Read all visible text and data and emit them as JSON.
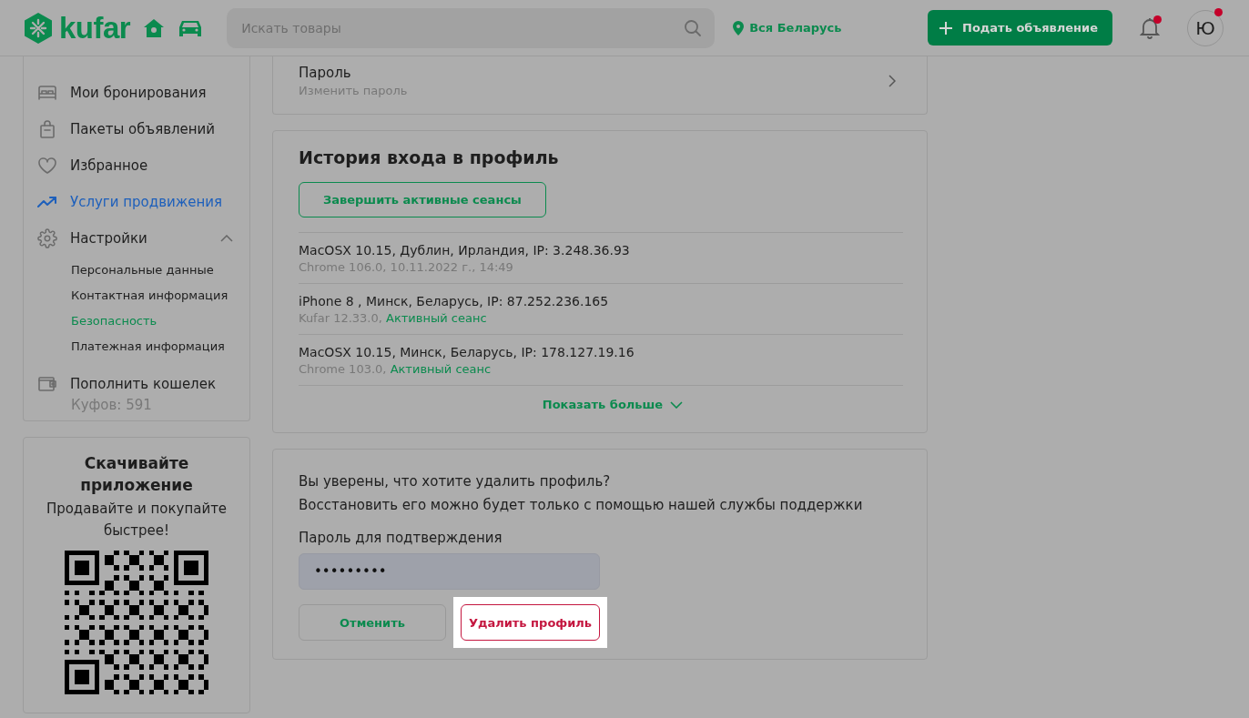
{
  "header": {
    "logo_text": "kufar",
    "search": {
      "placeholder": "Искать товары"
    },
    "location": "Вся Беларусь",
    "post_button": "Подать объявление",
    "notifications": {
      "unread": true
    },
    "avatar": {
      "letter": "Ю",
      "unread": true
    }
  },
  "sidebar": {
    "items": [
      {
        "label": "Мои бронирования",
        "highlighted": false
      },
      {
        "label": "Пакеты объявлений",
        "highlighted": false
      },
      {
        "label": "Избранное",
        "highlighted": false
      },
      {
        "label": "Услуги продвижения",
        "highlighted": true
      },
      {
        "label": "Настройки",
        "highlighted": false,
        "expanded": true,
        "children": [
          {
            "label": "Персональные данные",
            "selected": false
          },
          {
            "label": "Контактная информация",
            "selected": false
          },
          {
            "label": "Безопасность",
            "selected": true
          },
          {
            "label": "Платежная информация",
            "selected": false
          }
        ]
      },
      {
        "label": "Пополнить кошелек",
        "highlighted": false,
        "subtitle": "Куфов: 591"
      }
    ]
  },
  "app_promo": {
    "title": "Скачивайте приложение",
    "text": "Продавайте и покупайте быстрее!"
  },
  "password_card": {
    "title": "Пароль",
    "subtitle": "Изменить пароль"
  },
  "login_history": {
    "title": "История входа в профиль",
    "end_sessions_button": "Завершить активные сеансы",
    "sessions": [
      {
        "device": "MacOSX 10.15, Дублин, Ирландия, IP: 3.248.36.93",
        "details": "Chrome 106.0, 10.11.2022 г., 14:49"
      },
      {
        "device": "iPhone 8 , Минск, Беларусь, IP: 87.252.236.165",
        "details": "Kufar 12.33.0,",
        "status": "Активный сеанс"
      },
      {
        "device": "MacOSX 10.15, Минск, Беларусь, IP: 178.127.19.16",
        "details": "Chrome 103.0,",
        "status": "Активный сеанс"
      }
    ],
    "show_more": "Показать больше"
  },
  "delete_profile": {
    "question": "Вы уверены, что хотите удалить профиль?",
    "note": "Восстановить его можно будет только с помощью нашей службы поддержки",
    "password_label": "Пароль для подтверждения",
    "password_value": "•••••••••",
    "cancel_button": "Отменить",
    "delete_button": "Удалить профиль",
    "delete_highlighted": true
  }
}
